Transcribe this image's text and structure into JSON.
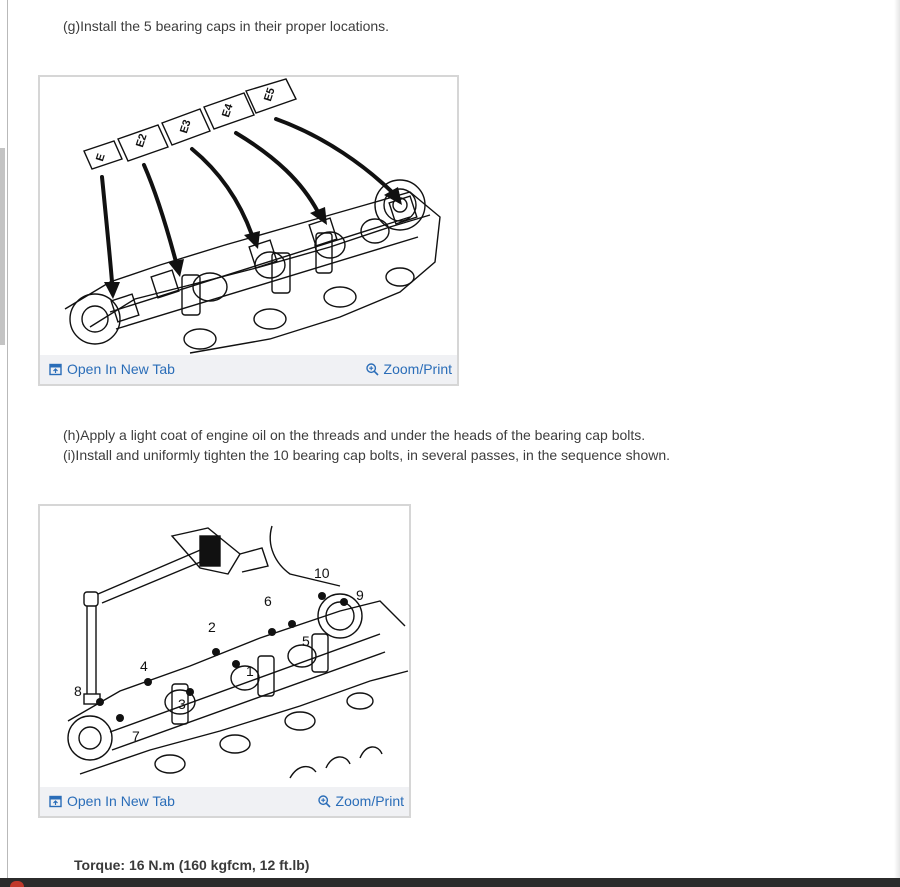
{
  "steps": {
    "g": "(g)Install the 5 bearing caps in their proper locations.",
    "h": "(h)Apply a light coat of engine oil on the threads and under the heads of the bearing cap bolts.",
    "i": "(i)Install and uniformly tighten the 10 bearing cap bolts, in several passes, in the sequence shown."
  },
  "figure1": {
    "open_tab_label": "Open In New Tab",
    "zoom_label": "Zoom/Print",
    "cap_labels": [
      "E",
      "E2",
      "E3",
      "E4",
      "E5"
    ]
  },
  "figure2": {
    "open_tab_label": "Open In New Tab",
    "zoom_label": "Zoom/Print",
    "bolt_numbers": [
      "1",
      "2",
      "3",
      "4",
      "5",
      "6",
      "7",
      "8",
      "9",
      "10"
    ]
  },
  "torque": "Torque: 16 N.m (160 kgfcm, 12 ft.lb)",
  "icons": {
    "open_tab": "open-new-tab-icon",
    "zoom": "zoom-in-icon"
  },
  "colors": {
    "link": "#2a6db8",
    "caption_bar": "#f0f1f4",
    "figure_border": "#d6d6d6"
  }
}
